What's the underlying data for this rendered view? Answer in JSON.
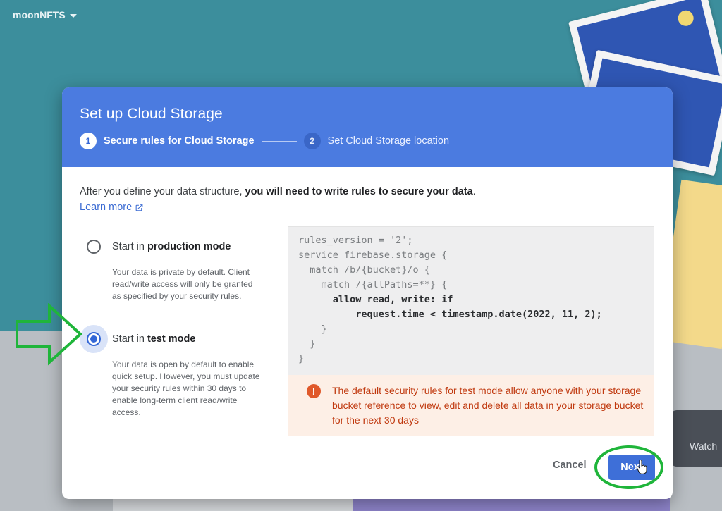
{
  "app": {
    "project_name": "moonNFTS",
    "watch_label": "Watch"
  },
  "dialog": {
    "title": "Set up Cloud Storage",
    "steps": [
      {
        "number": "1",
        "label": "Secure rules for Cloud Storage",
        "active": true
      },
      {
        "number": "2",
        "label": "Set Cloud Storage location",
        "active": false
      }
    ],
    "intro_plain": "After you define your data structure, ",
    "intro_bold": "you will need to write rules to secure your data",
    "intro_end": ".",
    "learn_more": "Learn more",
    "modes": [
      {
        "title_prefix": "Start in ",
        "title_bold": "production mode",
        "description": "Your data is private by default. Client read/write access will only be granted as specified by your security rules.",
        "selected": false
      },
      {
        "title_prefix": "Start in ",
        "title_bold": "test mode",
        "description": "Your data is open by default to enable quick setup. However, you must update your security rules within 30 days to enable long-term client read/write access.",
        "selected": true
      }
    ],
    "code_lines": [
      "rules_version = '2';",
      "service firebase.storage {",
      "  match /b/{bucket}/o {",
      "    match /{allPaths=**} {",
      "      allow read, write: if",
      "          request.time < timestamp.date(2022, 11, 2);",
      "    }",
      "  }",
      "}"
    ],
    "warning_text": "The default security rules for test mode allow anyone with your storage bucket reference to view, edit and delete all data in your storage bucket for the next 30 days",
    "cancel_label": "Cancel",
    "next_label": "Next"
  },
  "colors": {
    "header_blue": "#4b7be0",
    "primary_button": "#3e6fd8",
    "warning_text": "#c0390f",
    "warning_bg": "#fdefe6",
    "annotation_green": "#1fb53a"
  }
}
